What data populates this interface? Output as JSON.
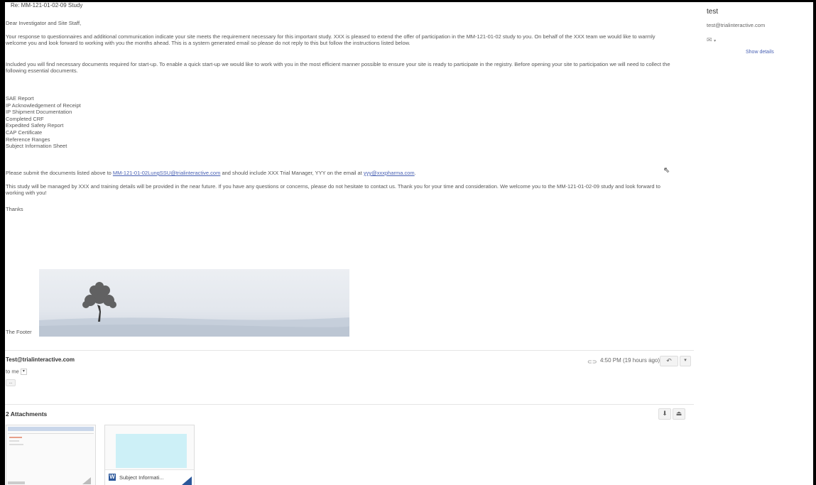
{
  "email": {
    "subject": "Re: MM-121-01-02-09 Study",
    "greeting": "Dear Investigator and Site Staff,",
    "para1": "Your response to questionnaires and additional communication indicate your site meets the requirement necessary for this important study.  XXX is pleased to extend the offer of participation in the MM-121-01-02 study to you.  On behalf of the XXX team we would like to warmly welcome you and look forward to working with you the months ahead.  This is a system generated email so please do not reply to this but follow the instructions listed below.",
    "para2": "Included you will find necessary documents required for start-up.  To enable a quick start-up we would like to work with you in the most efficient manner possible to ensure your site is ready to participate in the registry. Before opening your site to participation we will need to collect the following essential documents.",
    "documents": [
      "SAE Report",
      "IP Acknowledgement of Receipt",
      "IP Shipment Documentation",
      "Completed CRF",
      "Expedited Safety Report",
      "CAP Certificate",
      "Reference Ranges",
      "Subject Information Sheet"
    ],
    "submit_pre": "Please submit the documents listed above to ",
    "submit_link1": "MM-121-01-02LungSSU@trialinteractive.com",
    "submit_mid": " and should include XXX Trial Manager, YYY on the email at ",
    "submit_link2": "yyy@xxxpharma.com",
    "submit_end": ".",
    "para4": "This study will be managed by  XXX and training details will be provided in the near future.  If you have any questions or concerns, please do not hesitate to contact us.  Thank you for your time and consideration.  We welcome you to the MM-121-01-02-09 study and look forward to working with you!",
    "thanks": "Thanks",
    "footer_label": "The Footer"
  },
  "reply_header": {
    "sender": "Test@trialinteractive.com",
    "to": "to me",
    "time": "4:50 PM (19 hours ago)",
    "dots": "..."
  },
  "attachments": {
    "title": "2 Attachments",
    "file2_name": "Subject Informati...",
    "file2_icon": "W"
  },
  "sidebar": {
    "name": "test",
    "email": "test@trialinteractive.com",
    "show_details": "Show details"
  }
}
